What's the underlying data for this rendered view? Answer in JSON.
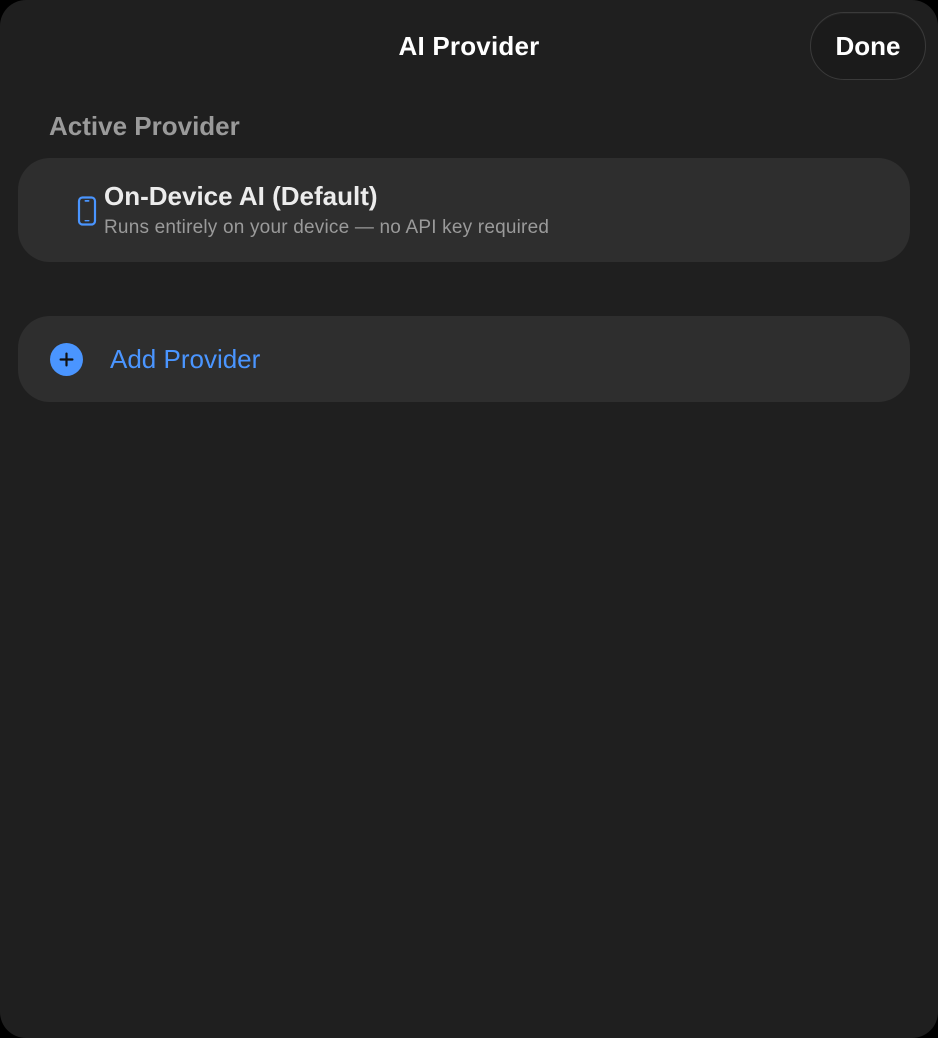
{
  "header": {
    "title": "AI Provider",
    "done_label": "Done"
  },
  "active_section": {
    "label": "Active Provider",
    "provider": {
      "icon": "iphone-icon",
      "name": "On-Device AI (Default)",
      "description": "Runs entirely on your device — no API key required"
    }
  },
  "add_provider": {
    "icon": "plus-circle-icon",
    "label": "Add Provider"
  },
  "colors": {
    "background": "#1f1f1f",
    "card": "#2e2e2e",
    "accent": "#4a95ff",
    "secondary_text": "#9a9a9a"
  }
}
